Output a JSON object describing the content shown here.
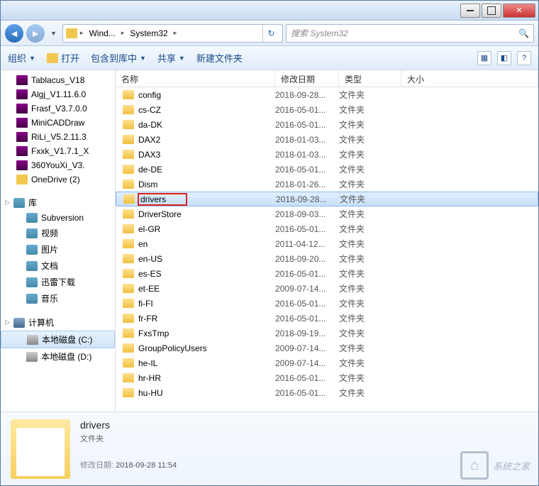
{
  "titlebar": {},
  "nav": {
    "crumbs": [
      "Wind...",
      "System32"
    ],
    "search_placeholder": "搜索 System32"
  },
  "toolbar": {
    "organize": "组织",
    "open": "打开",
    "include": "包含到库中",
    "share": "共享",
    "newfolder": "新建文件夹"
  },
  "sidebar": {
    "recent": [
      {
        "label": "Tablacus_V18"
      },
      {
        "label": "Algj_V1.11.6.0"
      },
      {
        "label": "Frasf_V3.7.0.0"
      },
      {
        "label": "MiniCADDraw"
      },
      {
        "label": "RiLi_V5.2.11.3"
      },
      {
        "label": "Fxxk_V1.7.1_X"
      },
      {
        "label": "360YouXi_V3."
      },
      {
        "label": "OneDrive (2)"
      }
    ],
    "lib_label": "库",
    "libs": [
      {
        "label": "Subversion"
      },
      {
        "label": "视频"
      },
      {
        "label": "图片"
      },
      {
        "label": "文档"
      },
      {
        "label": "迅雷下载"
      },
      {
        "label": "音乐"
      }
    ],
    "comp_label": "计算机",
    "drives": [
      {
        "label": "本地磁盘 (C:)",
        "sel": true
      },
      {
        "label": "本地磁盘 (D:)"
      }
    ]
  },
  "columns": {
    "name": "名称",
    "date": "修改日期",
    "type": "类型",
    "size": "大小"
  },
  "files": [
    {
      "name": "config",
      "date": "2018-09-28...",
      "type": "文件夹"
    },
    {
      "name": "cs-CZ",
      "date": "2016-05-01...",
      "type": "文件夹"
    },
    {
      "name": "da-DK",
      "date": "2016-05-01...",
      "type": "文件夹"
    },
    {
      "name": "DAX2",
      "date": "2018-01-03...",
      "type": "文件夹"
    },
    {
      "name": "DAX3",
      "date": "2018-01-03...",
      "type": "文件夹"
    },
    {
      "name": "de-DE",
      "date": "2016-05-01...",
      "type": "文件夹"
    },
    {
      "name": "Dism",
      "date": "2018-01-26...",
      "type": "文件夹"
    },
    {
      "name": "drivers",
      "date": "2018-09-28...",
      "type": "文件夹",
      "selected": true,
      "highlight": true
    },
    {
      "name": "DriverStore",
      "date": "2018-09-03...",
      "type": "文件夹"
    },
    {
      "name": "el-GR",
      "date": "2016-05-01...",
      "type": "文件夹"
    },
    {
      "name": "en",
      "date": "2011-04-12...",
      "type": "文件夹"
    },
    {
      "name": "en-US",
      "date": "2018-09-20...",
      "type": "文件夹"
    },
    {
      "name": "es-ES",
      "date": "2016-05-01...",
      "type": "文件夹"
    },
    {
      "name": "et-EE",
      "date": "2009-07-14...",
      "type": "文件夹"
    },
    {
      "name": "fi-FI",
      "date": "2016-05-01...",
      "type": "文件夹"
    },
    {
      "name": "fr-FR",
      "date": "2016-05-01...",
      "type": "文件夹"
    },
    {
      "name": "FxsTmp",
      "date": "2018-09-19...",
      "type": "文件夹"
    },
    {
      "name": "GroupPolicyUsers",
      "date": "2009-07-14...",
      "type": "文件夹"
    },
    {
      "name": "he-IL",
      "date": "2009-07-14...",
      "type": "文件夹"
    },
    {
      "name": "hr-HR",
      "date": "2016-05-01...",
      "type": "文件夹"
    },
    {
      "name": "hu-HU",
      "date": "2016-05-01...",
      "type": "文件夹"
    }
  ],
  "details": {
    "name": "drivers",
    "type": "文件夹",
    "date_label": "修改日期:",
    "date_value": "2018-09-28 11:54"
  },
  "watermark": "系统之家"
}
